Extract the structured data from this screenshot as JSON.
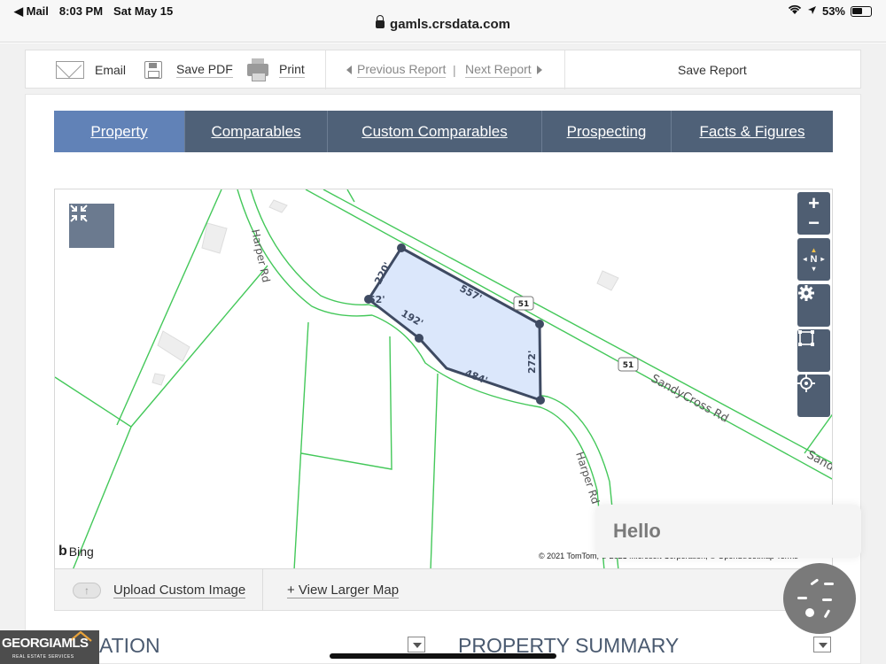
{
  "status_bar": {
    "back_app": "◀ Mail",
    "time": "8:03 PM",
    "date": "Sat May 15",
    "battery": "53%",
    "url": "gamls.crsdata.com"
  },
  "toolbar": {
    "email": "Email",
    "save_pdf": "Save PDF",
    "print": "Print",
    "previous_report": "Previous Report",
    "separator": "|",
    "next_report": "Next Report",
    "save_report": "Save Report"
  },
  "tabs": [
    {
      "label": "Property",
      "active": true
    },
    {
      "label": "Comparables",
      "active": false
    },
    {
      "label": "Custom Comparables",
      "active": false
    },
    {
      "label": "Prospecting",
      "active": false
    },
    {
      "label": "Facts & Figures",
      "active": false
    }
  ],
  "map": {
    "road_labels": [
      "Harper Rd",
      "Harper Rd",
      "SandyCross Rd",
      "Sand"
    ],
    "route_shield": "51",
    "dimensions": [
      "220'",
      "557'",
      "272'",
      "484'",
      "192'",
      "52'"
    ],
    "compass_label": "N",
    "zoom_in": "+",
    "zoom_out": "−",
    "attribution_brand": "Bing",
    "copyright": "© 2021 TomTom, © 2021 Microsoft Corporation, © OpenStreetMap Terms",
    "parcel_fill": "#dbe7fb",
    "parcel_stroke": "#3e4a62",
    "lot_line_color": "#44c85a"
  },
  "map_footer": {
    "upload": "Upload Custom Image",
    "view_larger": "+ View Larger Map"
  },
  "chat": {
    "greeting": "Hello"
  },
  "sections": {
    "left": "ATION",
    "right": "PROPERTY SUMMARY"
  },
  "logo": {
    "brand": "GEORGIAMLS",
    "tagline": "REAL ESTATE SERVICES"
  }
}
